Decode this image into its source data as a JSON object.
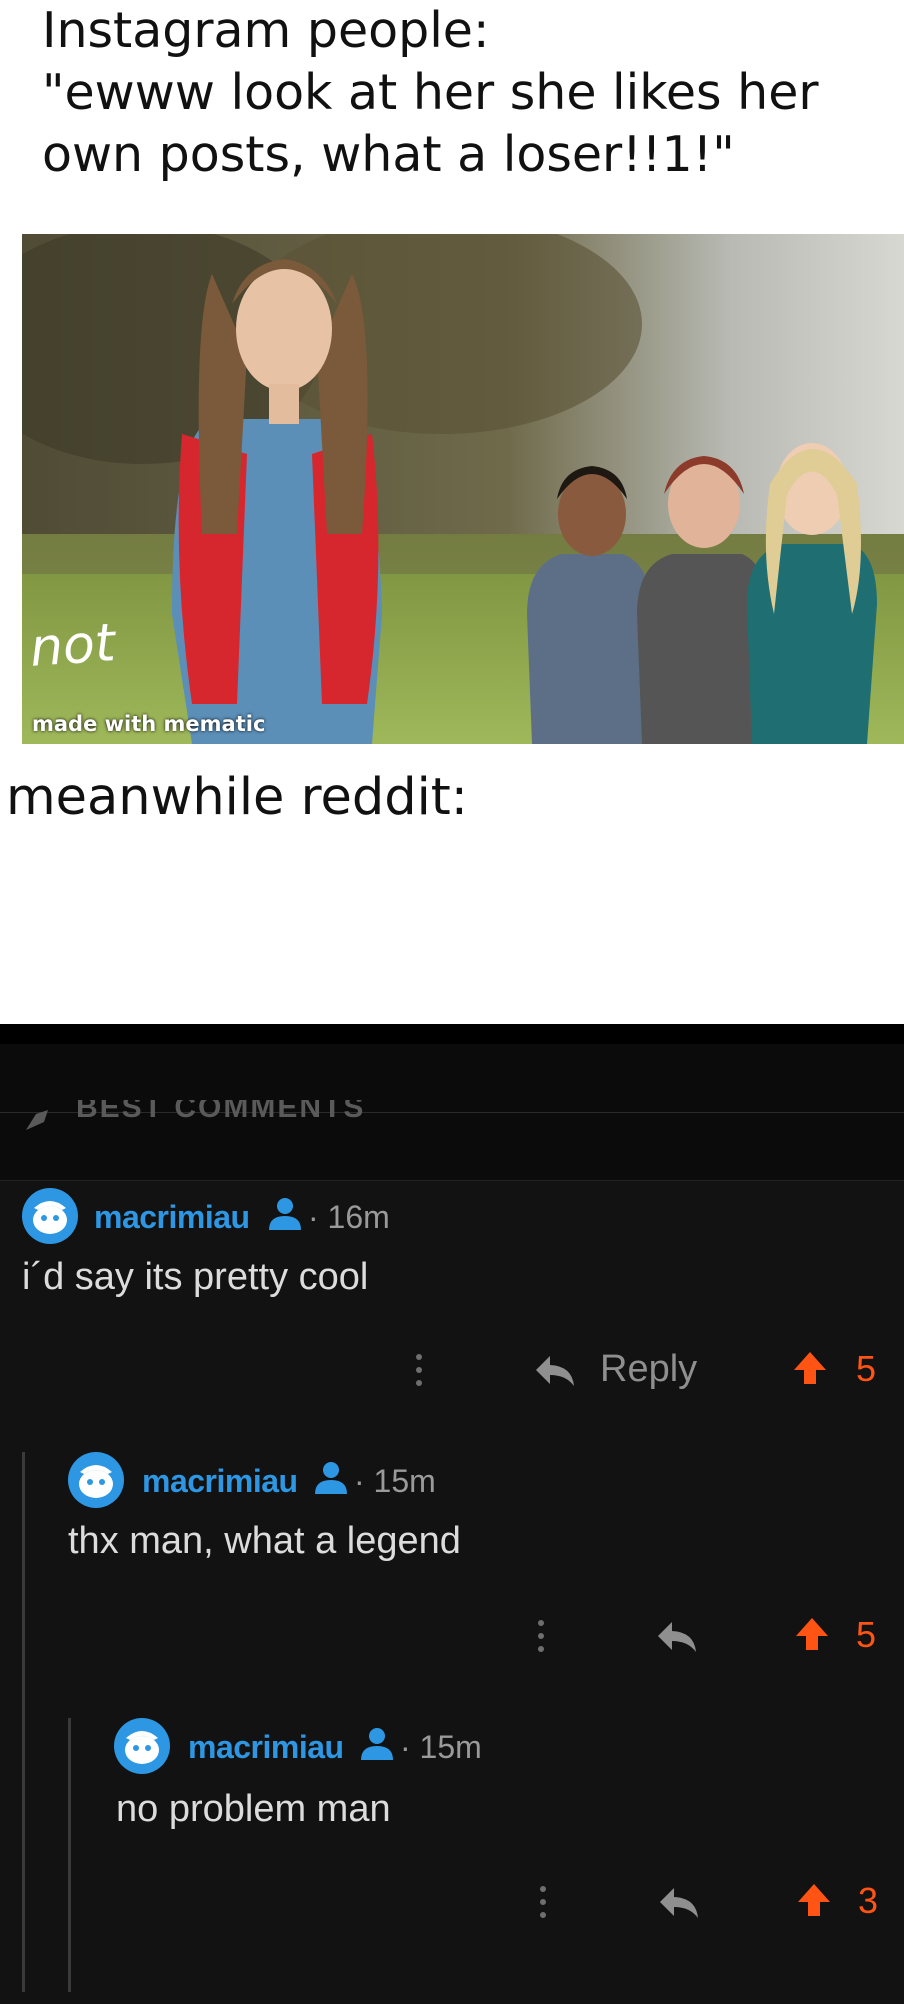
{
  "caption_top": [
    "Instagram people:",
    "\"ewww look at her she likes her",
    "own posts, what a loser!!1!\""
  ],
  "scribble": "not",
  "watermark": "made with mematic",
  "caption_mid": "meanwhile reddit:",
  "reddit": {
    "sort_label": "BEST COMMENTS",
    "colors": {
      "accent": "#2d97e3",
      "upvote": "#ff5414",
      "background": "#121212"
    },
    "comments": [
      {
        "username": "macrimiau",
        "time": "· 16m",
        "body": "i´d say its pretty cool",
        "reply_label": "Reply",
        "score": "5"
      },
      {
        "username": "macrimiau",
        "time": "· 15m",
        "body": "thx man, what a legend",
        "score": "5"
      },
      {
        "username": "macrimiau",
        "time": "· 15m",
        "body": "no problem man",
        "score": "3"
      }
    ]
  }
}
